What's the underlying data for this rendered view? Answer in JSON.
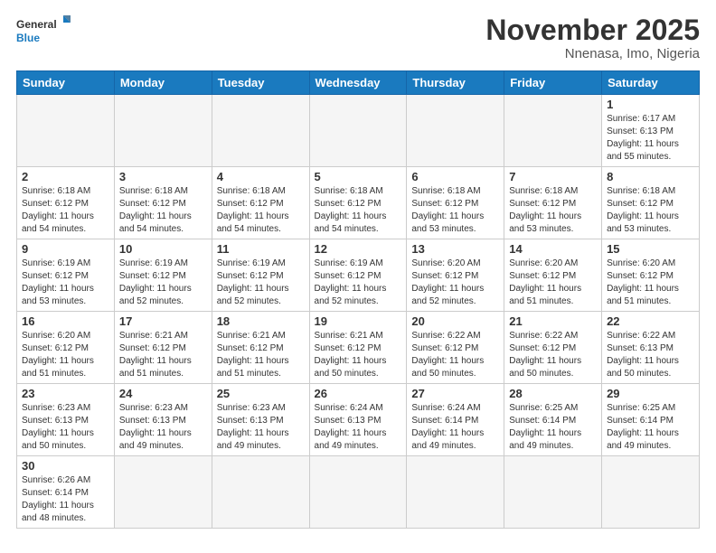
{
  "header": {
    "logo_general": "General",
    "logo_blue": "Blue",
    "month_title": "November 2025",
    "location": "Nnenasa, Imo, Nigeria"
  },
  "weekdays": [
    "Sunday",
    "Monday",
    "Tuesday",
    "Wednesday",
    "Thursday",
    "Friday",
    "Saturday"
  ],
  "weeks": [
    [
      {
        "day": null,
        "info": null
      },
      {
        "day": null,
        "info": null
      },
      {
        "day": null,
        "info": null
      },
      {
        "day": null,
        "info": null
      },
      {
        "day": null,
        "info": null
      },
      {
        "day": null,
        "info": null
      },
      {
        "day": "1",
        "info": "Sunrise: 6:17 AM\nSunset: 6:13 PM\nDaylight: 11 hours\nand 55 minutes."
      }
    ],
    [
      {
        "day": "2",
        "info": "Sunrise: 6:18 AM\nSunset: 6:12 PM\nDaylight: 11 hours\nand 54 minutes."
      },
      {
        "day": "3",
        "info": "Sunrise: 6:18 AM\nSunset: 6:12 PM\nDaylight: 11 hours\nand 54 minutes."
      },
      {
        "day": "4",
        "info": "Sunrise: 6:18 AM\nSunset: 6:12 PM\nDaylight: 11 hours\nand 54 minutes."
      },
      {
        "day": "5",
        "info": "Sunrise: 6:18 AM\nSunset: 6:12 PM\nDaylight: 11 hours\nand 54 minutes."
      },
      {
        "day": "6",
        "info": "Sunrise: 6:18 AM\nSunset: 6:12 PM\nDaylight: 11 hours\nand 53 minutes."
      },
      {
        "day": "7",
        "info": "Sunrise: 6:18 AM\nSunset: 6:12 PM\nDaylight: 11 hours\nand 53 minutes."
      },
      {
        "day": "8",
        "info": "Sunrise: 6:18 AM\nSunset: 6:12 PM\nDaylight: 11 hours\nand 53 minutes."
      }
    ],
    [
      {
        "day": "9",
        "info": "Sunrise: 6:19 AM\nSunset: 6:12 PM\nDaylight: 11 hours\nand 53 minutes."
      },
      {
        "day": "10",
        "info": "Sunrise: 6:19 AM\nSunset: 6:12 PM\nDaylight: 11 hours\nand 52 minutes."
      },
      {
        "day": "11",
        "info": "Sunrise: 6:19 AM\nSunset: 6:12 PM\nDaylight: 11 hours\nand 52 minutes."
      },
      {
        "day": "12",
        "info": "Sunrise: 6:19 AM\nSunset: 6:12 PM\nDaylight: 11 hours\nand 52 minutes."
      },
      {
        "day": "13",
        "info": "Sunrise: 6:20 AM\nSunset: 6:12 PM\nDaylight: 11 hours\nand 52 minutes."
      },
      {
        "day": "14",
        "info": "Sunrise: 6:20 AM\nSunset: 6:12 PM\nDaylight: 11 hours\nand 51 minutes."
      },
      {
        "day": "15",
        "info": "Sunrise: 6:20 AM\nSunset: 6:12 PM\nDaylight: 11 hours\nand 51 minutes."
      }
    ],
    [
      {
        "day": "16",
        "info": "Sunrise: 6:20 AM\nSunset: 6:12 PM\nDaylight: 11 hours\nand 51 minutes."
      },
      {
        "day": "17",
        "info": "Sunrise: 6:21 AM\nSunset: 6:12 PM\nDaylight: 11 hours\nand 51 minutes."
      },
      {
        "day": "18",
        "info": "Sunrise: 6:21 AM\nSunset: 6:12 PM\nDaylight: 11 hours\nand 51 minutes."
      },
      {
        "day": "19",
        "info": "Sunrise: 6:21 AM\nSunset: 6:12 PM\nDaylight: 11 hours\nand 50 minutes."
      },
      {
        "day": "20",
        "info": "Sunrise: 6:22 AM\nSunset: 6:12 PM\nDaylight: 11 hours\nand 50 minutes."
      },
      {
        "day": "21",
        "info": "Sunrise: 6:22 AM\nSunset: 6:12 PM\nDaylight: 11 hours\nand 50 minutes."
      },
      {
        "day": "22",
        "info": "Sunrise: 6:22 AM\nSunset: 6:13 PM\nDaylight: 11 hours\nand 50 minutes."
      }
    ],
    [
      {
        "day": "23",
        "info": "Sunrise: 6:23 AM\nSunset: 6:13 PM\nDaylight: 11 hours\nand 50 minutes."
      },
      {
        "day": "24",
        "info": "Sunrise: 6:23 AM\nSunset: 6:13 PM\nDaylight: 11 hours\nand 49 minutes."
      },
      {
        "day": "25",
        "info": "Sunrise: 6:23 AM\nSunset: 6:13 PM\nDaylight: 11 hours\nand 49 minutes."
      },
      {
        "day": "26",
        "info": "Sunrise: 6:24 AM\nSunset: 6:13 PM\nDaylight: 11 hours\nand 49 minutes."
      },
      {
        "day": "27",
        "info": "Sunrise: 6:24 AM\nSunset: 6:14 PM\nDaylight: 11 hours\nand 49 minutes."
      },
      {
        "day": "28",
        "info": "Sunrise: 6:25 AM\nSunset: 6:14 PM\nDaylight: 11 hours\nand 49 minutes."
      },
      {
        "day": "29",
        "info": "Sunrise: 6:25 AM\nSunset: 6:14 PM\nDaylight: 11 hours\nand 49 minutes."
      }
    ],
    [
      {
        "day": "30",
        "info": "Sunrise: 6:26 AM\nSunset: 6:14 PM\nDaylight: 11 hours\nand 48 minutes."
      },
      {
        "day": null,
        "info": null
      },
      {
        "day": null,
        "info": null
      },
      {
        "day": null,
        "info": null
      },
      {
        "day": null,
        "info": null
      },
      {
        "day": null,
        "info": null
      },
      {
        "day": null,
        "info": null
      }
    ]
  ]
}
